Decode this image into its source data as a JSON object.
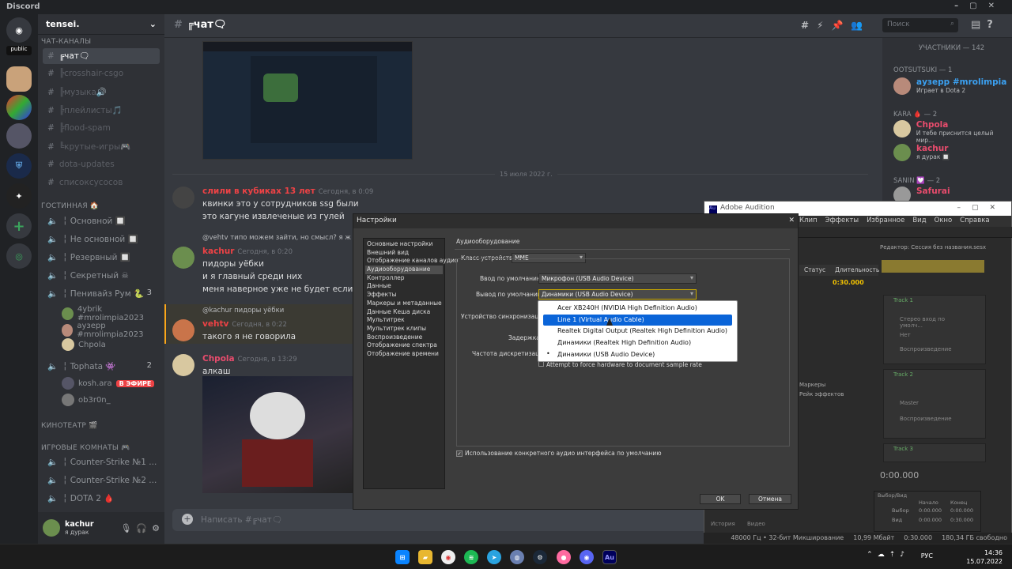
{
  "discord": {
    "app_title": "Discord",
    "server_badge": "public",
    "server_name": "tensei.",
    "categories": {
      "chat": "ЧАТ-КАНАЛЫ",
      "lounge": "ГОСТИННАЯ 🏠",
      "cinema": "КИНОТЕАТР 🎬",
      "games": "ИГРОВЫЕ КОМНАТЫ 🎮"
    },
    "text_channels": [
      {
        "name": "╔чат🗨",
        "state": "active"
      },
      {
        "name": "╠crosshair-csgo",
        "state": "muted"
      },
      {
        "name": "╠музыка🔊",
        "state": "muted"
      },
      {
        "name": "╠плейлисты🎵",
        "state": "muted"
      },
      {
        "name": "╠flood-spam",
        "state": "muted"
      },
      {
        "name": "╚крутые-игры🎮",
        "state": "muted"
      },
      {
        "name": "dota-updates",
        "state": "muted"
      },
      {
        "name": "списоксусосов",
        "state": "muted"
      }
    ],
    "voice_channels": [
      {
        "name": "╎ Основной 🔲"
      },
      {
        "name": "╎ Не основной 🔲"
      },
      {
        "name": "╎ Резервный 🔲"
      },
      {
        "name": "╎ Секретный ☠"
      },
      {
        "name": "╎ Пенивайз Рум 🐍",
        "count": "3"
      }
    ],
    "voice_users_pennywise": [
      "4ybrik #mrolimpia2023",
      "аузерр #mrolimpia2023",
      "Chpola"
    ],
    "tophata": {
      "name": "╎ Tophata 👾",
      "count": "2"
    },
    "voice_users_tophata": [
      {
        "name": "kosh.ara",
        "badge": "В ЭФИРЕ"
      },
      {
        "name": "ob3r0n_"
      }
    ],
    "game_channels": [
      "╎ Counter-Strike №1 ...",
      "╎ Counter-Strike №2 ...",
      "╎ DOTA 2 🩸"
    ],
    "user": {
      "name": "kachur",
      "status": "я дурак"
    },
    "channel_header": "╔чат🗨",
    "search_placeholder": "Поиск",
    "date_divider": "15 июля 2022 г.",
    "messages": [
      {
        "author": "слили в кубиках 13 лет",
        "time": "Сегодня, в 0:09",
        "color": "#ed4245",
        "lines": [
          "квинки это у сотрудников ssg были",
          "это кагуне извлеченые из гулей"
        ]
      },
      {
        "reply": "@vehtv типо можем зайти, но смысл? я ж н",
        "author": "kachur",
        "time": "Сегодня, в 0:20",
        "color": "#ed4245",
        "lines": [
          "пидоры уёбки",
          "и я главный среди них",
          "меня наверное уже не будет если начнёт"
        ]
      },
      {
        "reply": "@kachur пидоры уёбки",
        "author": "vehtv",
        "time": "Сегодня, в 0:22",
        "color": "#ed4245",
        "lines": [
          "такого я не говорила"
        ]
      },
      {
        "author": "Chpola",
        "time": "Сегодня, в 13:29",
        "color": "#e94c6d",
        "lines": [
          "алкаш"
        ]
      }
    ],
    "input_placeholder": "Написать #╔чат🗨",
    "members_header": "УЧАСТНИКИ — 142",
    "member_groups": [
      {
        "title": "OOTSUTSUKI — 1",
        "members": [
          {
            "name": "аузерр #mrolimpia",
            "status": "Играет в Dota 2",
            "color": "#3ba1f2"
          }
        ]
      },
      {
        "title": "KARA 🩸 — 2",
        "members": [
          {
            "name": "Chpola",
            "status": "И тебе приснится целый мир...",
            "color": "#e94c6d"
          },
          {
            "name": "kachur",
            "status": "я дурак 🔲",
            "color": "#e94c6d"
          }
        ]
      },
      {
        "title": "SANIN 💟 — 2",
        "members": [
          {
            "name": "Safurai",
            "status": "",
            "color": "#e94c6d"
          }
        ]
      }
    ]
  },
  "audition": {
    "title": "Adobe Audition",
    "menu": [
      "Клип",
      "Эффекты",
      "Избранное",
      "Вид",
      "Окно",
      "Справка"
    ],
    "editor_label": "Редактор: Сессия без названия.sesx",
    "tracks": [
      "Track 1",
      "Track 2",
      "Track 3"
    ],
    "track1_input": "Стерео вход по умолч...",
    "none_label": "Нет",
    "playback_label": "Воспроизведение",
    "master_label": "Master",
    "status_col": "Статус",
    "duration_col": "Длительность",
    "duration_value": "0:30.000",
    "time_display": "0:00.000",
    "markers_tab": "Маркеры",
    "fx_rack": "Рейк эффектов",
    "selection_title": "Выбор/Вид",
    "selection_cols": [
      "Начало",
      "Конец"
    ],
    "selection_rows": [
      "Выбор",
      "Вид"
    ],
    "selection_values": [
      [
        "0:00.000",
        "0:00.000"
      ],
      [
        "0:00.000",
        "0:30.000"
      ]
    ],
    "bottom_tabs": [
      "История",
      "Видео"
    ],
    "status_bar": [
      "48000 Гц • 32-бит Микширование",
      "10,99 Мбайт",
      "0:30.000",
      "180,34 ГБ свободно"
    ]
  },
  "dialog": {
    "title": "Настройки",
    "categories": [
      "Основные настройки",
      "Внешний вид",
      "Отображение каналов аудио",
      "Аудиооборудование",
      "Контроллер",
      "Данные",
      "Эффекты",
      "Маркеры и метаданные",
      "Данные Кеша диска",
      "Мультитрек",
      "Мультитрек клипы",
      "Воспроизведение",
      "Отображение спектра",
      "Отображение времени"
    ],
    "selected_index": 3,
    "section_title": "Аудиооборудование",
    "device_class_label": "Класс устройства:",
    "device_class_value": "MME",
    "input_label": "Ввод по умолчанию:",
    "input_value": "Микрофон (USB Audio Device)",
    "output_label": "Вывод по умолчанию:",
    "output_value": "Динамики (USB Audio Device)",
    "sync_label": "Устройство синхронизации:",
    "latency_label": "Задержка:",
    "samplerate_label": "Частота дискретизации:",
    "force_rate_text": "Attempt to force hardware to document sample rate",
    "use_specific_text": "Использование конкретного аудио интерфейса по умолчанию",
    "ok": "OK",
    "cancel": "Отмена",
    "output_options": [
      {
        "label": "Acer XB240H (NVIDIA High Definition Audio)",
        "state": ""
      },
      {
        "label": "Line 1 (Virtual Audio Cable)",
        "state": "hl"
      },
      {
        "label": "Realtek Digital Output (Realtek High Definition Audio)",
        "state": ""
      },
      {
        "label": "Динамики (Realtek High Definition Audio)",
        "state": ""
      },
      {
        "label": "Динамики (USB Audio Device)",
        "state": "cur"
      }
    ]
  },
  "taskbar": {
    "lang": "РУС",
    "time": "14:36",
    "date": "15.07.2022"
  }
}
